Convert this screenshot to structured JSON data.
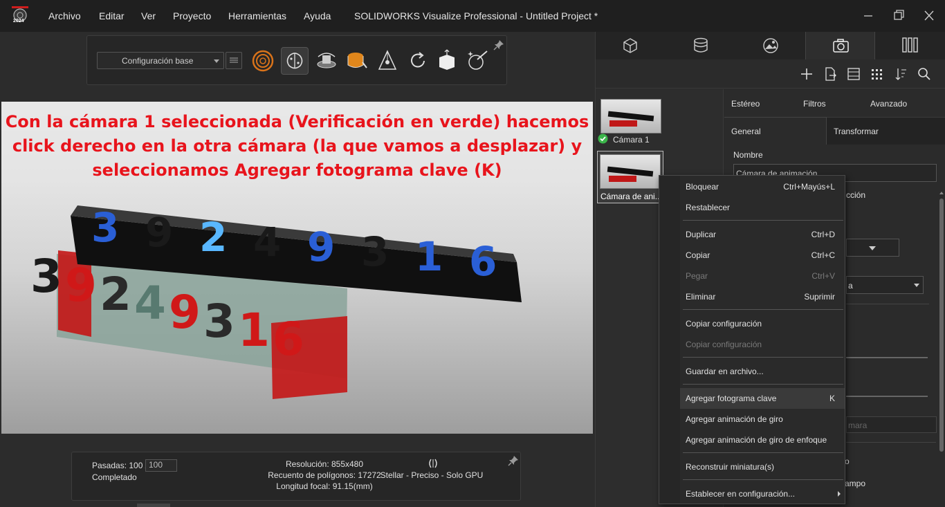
{
  "app": {
    "logo_year": "2024",
    "window_title": "SOLIDWORKS Visualize Professional - Untitled Project *"
  },
  "menu": [
    "Archivo",
    "Editar",
    "Ver",
    "Proyecto",
    "Herramientas",
    "Ayuda"
  ],
  "toolbar": {
    "config_value": "Configuración base",
    "icons": [
      "render-mode-icon",
      "brain-denoiser-icon",
      "turntable-icon",
      "material-bucket-icon",
      "triad-move-icon",
      "reset-icon",
      "box-transform-icon",
      "magic-wand-icon"
    ]
  },
  "viewport": {
    "annotation": "Con la cámara 1 seleccionada (Verificación en verde) hacemos click derecho en la otra cámara (la que vamos a desplazar) y seleccionamos Agregar fotograma clave (K)",
    "scene_digits_top": [
      "3",
      "9",
      "2",
      "4",
      "9",
      "3",
      "1",
      "6"
    ],
    "scene_digits_bottom": [
      "3",
      "9",
      "2",
      "4",
      "9",
      "3",
      "1",
      "6"
    ]
  },
  "status": {
    "passes_label": "Pasadas: 100 /",
    "passes_input": "100",
    "state": "Completado",
    "resolution": "Resolución: 855x480",
    "polygons": "Recuento de polígonos: 17272",
    "focal": "Longitud focal: 91.15(mm)",
    "render_mode": "Stellar - Preciso - Solo GPU"
  },
  "panel": {
    "tabs": [
      "models-tab",
      "appearances-tab",
      "scenes-tab",
      "cameras-tab",
      "libraries-tab"
    ],
    "toolbar_icons": [
      "add-icon",
      "export-icon",
      "layout-icon",
      "grid-icon",
      "sort-icon",
      "search-icon"
    ],
    "cameras": [
      {
        "label": "Cámara 1",
        "checked": true
      },
      {
        "label": "Cámara de ani..."
      }
    ],
    "subtabs_top": [
      "Estéreo",
      "Filtros",
      "Avanzado"
    ],
    "subtabs_bottom": [
      "General",
      "Transformar"
    ],
    "name_label": "Nombre",
    "name_value": "Cámara de animación",
    "partial_texts": [
      "cción",
      "a",
      "mara",
      "o",
      "ampo"
    ]
  },
  "context_menu": {
    "items": [
      {
        "label": "Bloquear",
        "shortcut": "Ctrl+Mayús+L"
      },
      {
        "label": "Restablecer",
        "shortcut": ""
      },
      {
        "label": "Duplicar",
        "shortcut": "Ctrl+D"
      },
      {
        "label": "Copiar",
        "shortcut": "Ctrl+C"
      },
      {
        "label": "Pegar",
        "shortcut": "Ctrl+V"
      },
      {
        "label": "Eliminar",
        "shortcut": "Suprimir"
      },
      {
        "label": "Copiar configuración",
        "shortcut": ""
      },
      {
        "label": "Copiar configuración",
        "shortcut": ""
      },
      {
        "label": "Guardar en archivo...",
        "shortcut": ""
      },
      {
        "label": "Agregar fotograma clave",
        "shortcut": "K"
      },
      {
        "label": "Agregar animación de giro",
        "shortcut": ""
      },
      {
        "label": "Agregar animación de giro de enfoque",
        "shortcut": ""
      },
      {
        "label": "Reconstruir miniatura(s)",
        "shortcut": ""
      },
      {
        "label": "Establecer en configuración...",
        "shortcut": ""
      }
    ]
  },
  "colors": {
    "annotation": "#e8141c",
    "arrow": "#e8141c",
    "check": "#3bb54a"
  }
}
